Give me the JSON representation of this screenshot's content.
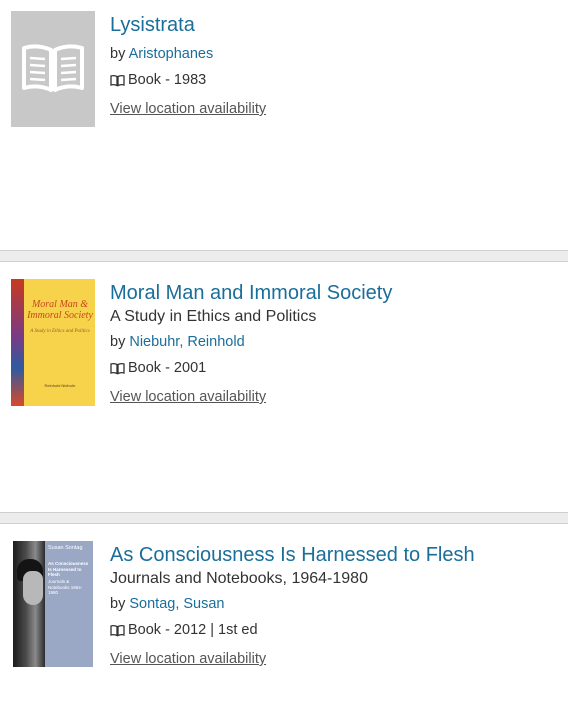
{
  "results": [
    {
      "title": "Lysistrata",
      "subtitle": "",
      "by_label": "by",
      "author": "Aristophanes",
      "format": "Book - 1983",
      "availability_link": "View location availability",
      "cover": "placeholder-book-icon"
    },
    {
      "title": "Moral Man and Immoral Society",
      "subtitle": "A Study in Ethics and Politics",
      "by_label": "by",
      "author": "Niebuhr, Reinhold",
      "format": "Book - 2001",
      "availability_link": "View location availability",
      "cover_text": {
        "title": "Moral Man & Immoral Society",
        "subtitle": "A Study in Ethics and Politics",
        "author": "Reinhold Niebuhr"
      }
    },
    {
      "title": "As Consciousness Is Harnessed to Flesh",
      "subtitle": "Journals and Notebooks, 1964-1980",
      "by_label": "by",
      "author": "Sontag, Susan",
      "format": "Book - 2012 | 1st ed",
      "availability_link": "View location availability",
      "cover_text": {
        "author": "Susan Sontag",
        "title": "As Consciousness Is Harnessed to Flesh",
        "subtitle": "Journals & Notebooks 1964-1980"
      }
    }
  ],
  "colors": {
    "link": "#1a6e9a",
    "text": "#333333",
    "separator": "#ececec"
  }
}
